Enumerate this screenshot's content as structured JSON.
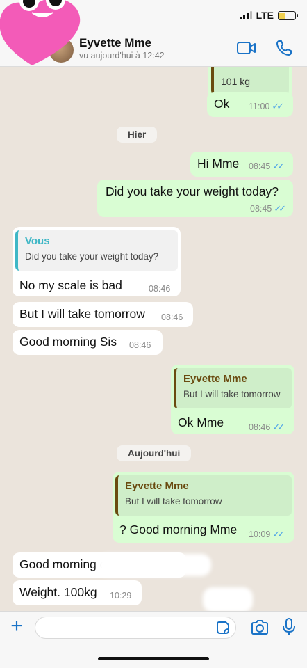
{
  "status": {
    "network": "LTE"
  },
  "header": {
    "contact_name": "Eyvette Mme",
    "last_seen": "vu aujourd'hui à 12:42"
  },
  "days": {
    "yesterday": "Hier",
    "today": "Aujourd'hui"
  },
  "messages": [
    {
      "id": "m0",
      "partial_text": "101 kg"
    },
    {
      "id": "m1",
      "text": "Ok",
      "time": "11:00"
    },
    {
      "id": "m2",
      "text": "Hi Mme",
      "time": "08:45"
    },
    {
      "id": "m3",
      "text": "Did you take your weight today?",
      "time": "08:45"
    },
    {
      "id": "m4",
      "quote_author": "Vous",
      "quote_text": "Did you take your weight today?",
      "text": "No my scale is bad",
      "time": "08:46"
    },
    {
      "id": "m5",
      "text": "But I will take tomorrow",
      "time": "08:46"
    },
    {
      "id": "m6",
      "text": "Good morning Sis",
      "time": "08:46"
    },
    {
      "id": "m7",
      "quote_author": "Eyvette Mme",
      "quote_text": "But I will take tomorrow",
      "text": "Ok Mme",
      "time": "08:46"
    },
    {
      "id": "m8",
      "quote_author": "Eyvette Mme",
      "quote_text": "But I will take tomorrow",
      "text": "? Good morning Mme",
      "time": "10:09"
    },
    {
      "id": "m9",
      "text": "Good morning darling"
    },
    {
      "id": "m10",
      "text": "Weight. 100kg",
      "time": "10:29"
    }
  ],
  "colors": {
    "outgoing": "#d9fdd3",
    "incoming": "#ffffff",
    "accent": "#1a73c7",
    "read_ticks": "#4fa4e8"
  },
  "icons": [
    "heart-sticker",
    "video-call-icon",
    "phone-icon",
    "plus-icon",
    "sticker-icon",
    "camera-icon",
    "mic-icon"
  ]
}
